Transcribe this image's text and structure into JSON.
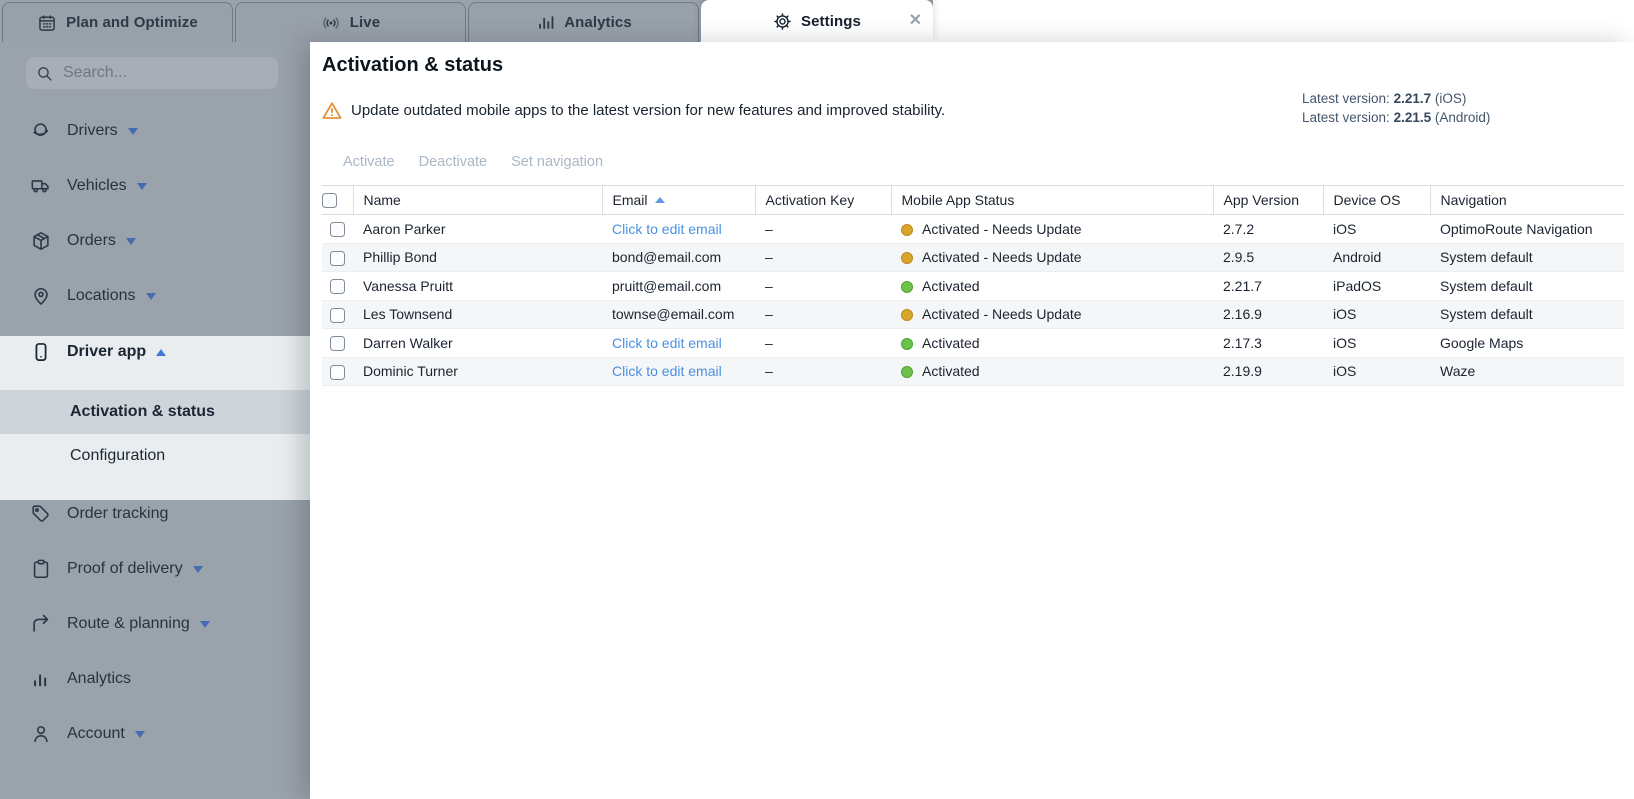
{
  "tabs": [
    {
      "label": "Plan and Optimize",
      "icon": "calendar-icon",
      "active": false
    },
    {
      "label": "Live",
      "icon": "live-broadcast-icon",
      "active": false
    },
    {
      "label": "Analytics",
      "icon": "bar-chart-icon",
      "active": false
    },
    {
      "label": "Settings",
      "icon": "gear-icon",
      "active": true,
      "closable": true
    }
  ],
  "tab_close_glyph": "✕",
  "sidebar": {
    "search_placeholder": "Search...",
    "items": [
      {
        "label": "Drivers",
        "icon": "drivers-cap-icon",
        "caret": "down"
      },
      {
        "label": "Vehicles",
        "icon": "truck-icon",
        "caret": "down"
      },
      {
        "label": "Orders",
        "icon": "package-icon",
        "caret": "down"
      },
      {
        "label": "Locations",
        "icon": "location-pin-icon",
        "caret": "down"
      },
      {
        "label": "Driver app",
        "icon": "smartphone-icon",
        "caret": "up",
        "expanded": true
      },
      {
        "label": "Activation & status",
        "sub": true,
        "selected": true
      },
      {
        "label": "Configuration",
        "sub": true
      },
      {
        "label": "Order tracking",
        "icon": "tag-icon"
      },
      {
        "label": "Proof of delivery",
        "icon": "clipboard-icon",
        "caret": "down"
      },
      {
        "label": "Route & planning",
        "icon": "route-arrow-icon",
        "caret": "down"
      },
      {
        "label": "Analytics",
        "icon": "bar-chart-icon"
      },
      {
        "label": "Account",
        "icon": "person-icon",
        "caret": "down"
      }
    ]
  },
  "page": {
    "title": "Activation & status",
    "warning": "Update outdated mobile apps to the latest version for new features and improved stability.",
    "latest_versions": [
      {
        "label": "Latest version:",
        "version": "2.21.7",
        "platform": "(iOS)"
      },
      {
        "label": "Latest version:",
        "version": "2.21.5",
        "platform": "(Android)"
      }
    ],
    "actions": [
      "Activate",
      "Deactivate",
      "Set navigation"
    ]
  },
  "table": {
    "columns": [
      "Name",
      "Email",
      "Activation Key",
      "Mobile App Status",
      "App Version",
      "Device OS",
      "Navigation"
    ],
    "sort_column": "Email",
    "sort_direction": "asc",
    "rows": [
      {
        "name": "Aaron Parker",
        "email": "Click to edit email",
        "email_is_link": true,
        "activation_key": "–",
        "status": "Activated - Needs Update",
        "status_color": "orange",
        "app_version": "2.7.2",
        "device_os": "iOS",
        "navigation": "OptimoRoute Navigation"
      },
      {
        "name": "Phillip Bond",
        "email": "bond@email.com",
        "email_is_link": false,
        "activation_key": "–",
        "status": "Activated - Needs Update",
        "status_color": "orange",
        "app_version": "2.9.5",
        "device_os": "Android",
        "navigation": "System default"
      },
      {
        "name": "Vanessa Pruitt",
        "email": "pruitt@email.com",
        "email_is_link": false,
        "activation_key": "–",
        "status": "Activated",
        "status_color": "green",
        "app_version": "2.21.7",
        "device_os": "iPadOS",
        "navigation": "System default"
      },
      {
        "name": "Les Townsend",
        "email": "townse@email.com",
        "email_is_link": false,
        "activation_key": "–",
        "status": "Activated - Needs Update",
        "status_color": "orange",
        "app_version": "2.16.9",
        "device_os": "iOS",
        "navigation": "System default"
      },
      {
        "name": "Darren Walker",
        "email": "Click to edit email",
        "email_is_link": true,
        "activation_key": "–",
        "status": "Activated",
        "status_color": "green",
        "app_version": "2.17.3",
        "device_os": "iOS",
        "navigation": "Google Maps"
      },
      {
        "name": "Dominic Turner",
        "email": "Click to edit email",
        "email_is_link": true,
        "activation_key": "–",
        "status": "Activated",
        "status_color": "green",
        "app_version": "2.19.9",
        "device_os": "iOS",
        "navigation": "Waze"
      }
    ]
  },
  "colors": {
    "link_blue": "#4a90e2",
    "accent_blue": "#3a7bd5",
    "warning_orange": "#e8923a",
    "status_orange": "#d9a62c",
    "status_orange_border": "#bd8a14",
    "status_green": "#6cc24d",
    "status_green_border": "#4da32c",
    "selected_sidebar_bg": "#ced4da",
    "sidebar_bg": "#9aa2ac"
  }
}
